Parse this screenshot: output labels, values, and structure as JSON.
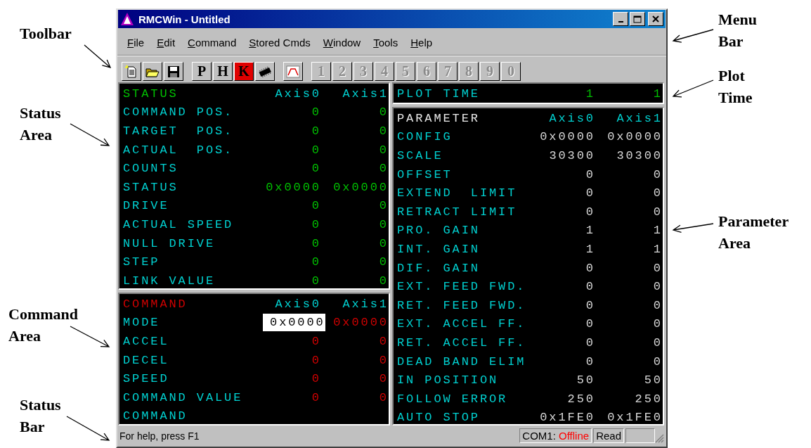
{
  "window": {
    "title": "RMCWin - Untitled"
  },
  "menu": [
    "File",
    "Edit",
    "Command",
    "Stored Cmds",
    "Window",
    "Tools",
    "Help"
  ],
  "toolbar": {
    "letter_buttons": [
      {
        "label": "P",
        "highlighted": false
      },
      {
        "label": "H",
        "highlighted": false
      },
      {
        "label": "K",
        "highlighted": true
      }
    ],
    "number_buttons": [
      {
        "label": "1",
        "disabled": true
      },
      {
        "label": "2",
        "disabled": true
      },
      {
        "label": "3",
        "disabled": true
      },
      {
        "label": "4",
        "disabled": true
      },
      {
        "label": "5",
        "disabled": true
      },
      {
        "label": "6",
        "disabled": true
      },
      {
        "label": "7",
        "disabled": true
      },
      {
        "label": "8",
        "disabled": true
      },
      {
        "label": "9",
        "disabled": true
      },
      {
        "label": "0",
        "disabled": true
      }
    ]
  },
  "panels": [
    {
      "kind": "status",
      "title": "STATUS",
      "columns": [
        "Axis0",
        "Axis1"
      ],
      "rows": [
        {
          "label": "COMMAND POS.",
          "values": [
            "0",
            "0"
          ]
        },
        {
          "label": "TARGET  POS.",
          "values": [
            "0",
            "0"
          ]
        },
        {
          "label": "ACTUAL  POS.",
          "values": [
            "0",
            "0"
          ]
        },
        {
          "label": "COUNTS",
          "values": [
            "0",
            "0"
          ]
        },
        {
          "label": "STATUS",
          "values": [
            "0x0000",
            "0x0000"
          ]
        },
        {
          "label": "DRIVE",
          "values": [
            "0",
            "0"
          ]
        },
        {
          "label": "ACTUAL SPEED",
          "values": [
            "0",
            "0"
          ]
        },
        {
          "label": "NULL DRIVE",
          "values": [
            "0",
            "0"
          ]
        },
        {
          "label": "STEP",
          "values": [
            "0",
            "0"
          ]
        },
        {
          "label": "LINK VALUE",
          "values": [
            "0",
            "0"
          ]
        }
      ]
    },
    {
      "kind": "command",
      "title": "COMMAND",
      "columns": [
        "Axis0",
        "Axis1"
      ],
      "rows": [
        {
          "label": "MODE",
          "values": [
            "0x0000",
            "0x0000"
          ],
          "editing": true
        },
        {
          "label": "ACCEL",
          "values": [
            "0",
            "0"
          ],
          "editing": false
        },
        {
          "label": "DECEL",
          "values": [
            "0",
            "0"
          ],
          "editing": false
        },
        {
          "label": "SPEED",
          "values": [
            "0",
            "0"
          ],
          "editing": false
        },
        {
          "label": "COMMAND VALUE",
          "values": [
            "0",
            "0"
          ],
          "editing": false
        },
        {
          "label": "COMMAND"
        }
      ]
    },
    {
      "kind": "plot",
      "rows": [
        {
          "label": "PLOT TIME",
          "values": [
            "1",
            "1"
          ]
        }
      ]
    },
    {
      "kind": "parameter",
      "title": "PARAMETER",
      "columns": [
        "Axis0",
        "Axis1"
      ],
      "rows": [
        {
          "label": "CONFIG",
          "values": [
            "0x0000",
            "0x0000"
          ]
        },
        {
          "label": "SCALE",
          "values": [
            "30300",
            "30300"
          ]
        },
        {
          "label": "OFFSET",
          "values": [
            "0",
            "0"
          ]
        },
        {
          "label": "EXTEND  LIMIT",
          "values": [
            "0",
            "0"
          ]
        },
        {
          "label": "RETRACT LIMIT",
          "values": [
            "0",
            "0"
          ]
        },
        {
          "label": "PRO. GAIN",
          "values": [
            "1",
            "1"
          ]
        },
        {
          "label": "INT. GAIN",
          "values": [
            "1",
            "1"
          ]
        },
        {
          "label": "DIF. GAIN",
          "values": [
            "0",
            "0"
          ]
        },
        {
          "label": "EXT. FEED FWD.",
          "values": [
            "0",
            "0"
          ]
        },
        {
          "label": "RET. FEED FWD.",
          "values": [
            "0",
            "0"
          ]
        },
        {
          "label": "EXT. ACCEL FF.",
          "values": [
            "0",
            "0"
          ]
        },
        {
          "label": "RET. ACCEL FF.",
          "values": [
            "0",
            "0"
          ]
        },
        {
          "label": "DEAD BAND ELIM",
          "values": [
            "0",
            "0"
          ]
        },
        {
          "label": "IN POSITION",
          "values": [
            "50",
            "50"
          ]
        },
        {
          "label": "FOLLOW ERROR",
          "values": [
            "250",
            "250"
          ]
        },
        {
          "label": "AUTO STOP",
          "values": [
            "0x1FE0",
            "0x1FE0"
          ]
        }
      ]
    }
  ],
  "status_bar": {
    "help": "For help, press F1",
    "port": "COM1:",
    "connection": "Offline",
    "online": false,
    "mode": "Read"
  },
  "callouts": [
    {
      "label": "Toolbar"
    },
    {
      "label": "Status Area"
    },
    {
      "label": "Command Area"
    },
    {
      "label": "Status Bar"
    },
    {
      "label": "Menu Bar"
    },
    {
      "label": "Plot Time"
    },
    {
      "label": "Parameter Area"
    }
  ]
}
